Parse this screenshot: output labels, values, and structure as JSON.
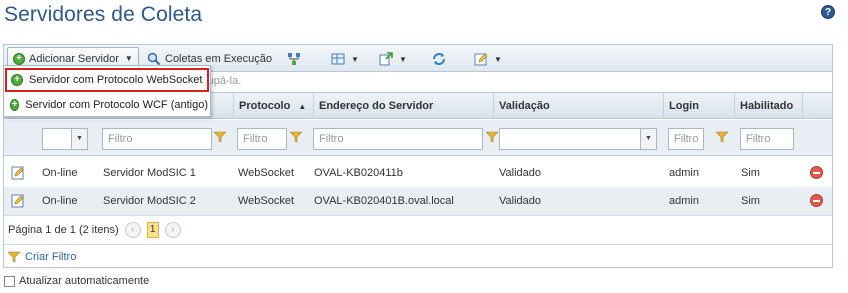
{
  "page": {
    "title": "Servidores de Coleta",
    "help_glyph": "?"
  },
  "toolbar": {
    "add_server_label": "Adicionar Servidor",
    "running_collections_label": "Coletas em Execução"
  },
  "group_hint": "rupá-la.",
  "columns": [
    {
      "label": "Protocolo"
    },
    {
      "label": "Endereço do Servidor"
    },
    {
      "label": "Validação"
    },
    {
      "label": "Login"
    },
    {
      "label": "Habilitado"
    }
  ],
  "filters": {
    "placeholder": "Filtro"
  },
  "rows": [
    {
      "status": "On-line",
      "name": "Servidor ModSIC 1",
      "protocol": "WebSocket",
      "address": "OVAL-KB020411b",
      "validation": "Validado",
      "login": "admin",
      "enabled": "Sim"
    },
    {
      "status": "On-line",
      "name": "Servidor ModSIC 2",
      "protocol": "WebSocket",
      "address": "OVAL-KB020401B.oval.local",
      "validation": "Validado",
      "login": "admin",
      "enabled": "Sim"
    }
  ],
  "pager": {
    "summary": "Página 1 de 1 (2 itens)",
    "current_page": "1",
    "prev_glyph": "‹",
    "next_glyph": "›"
  },
  "create_filter_label": "Criar Filtro",
  "auto_refresh_label": "Atualizar automaticamente",
  "menu": {
    "items": [
      {
        "label": "Servidor com Protocolo WebSocket"
      },
      {
        "label": "Servidor com Protocolo WCF (antigo)"
      }
    ]
  },
  "colors": {
    "accent": "#2d5a88",
    "highlight_border": "#d6201c",
    "add_green": "#4ea93d",
    "delete_red": "#e05a4f"
  },
  "icons": [
    "help-icon",
    "add-icon",
    "search-icon",
    "network-icon",
    "grid-icon",
    "export-icon",
    "refresh-icon",
    "edit-icon",
    "delete-icon",
    "funnel-icon"
  ]
}
